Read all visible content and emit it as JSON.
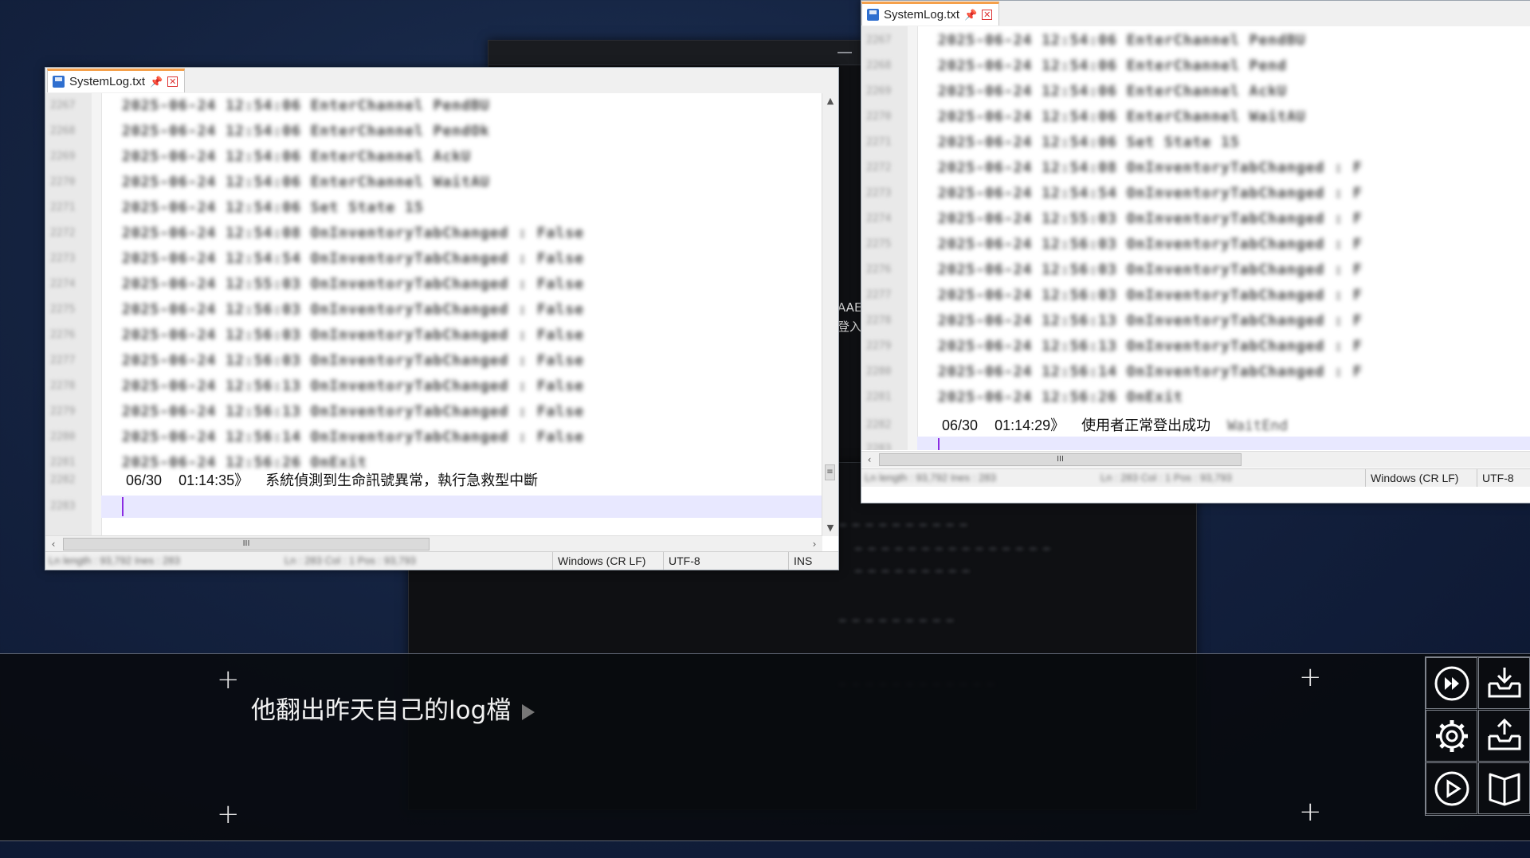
{
  "background_window": {
    "text_fragments": [
      "AAE",
      "登入"
    ]
  },
  "notepad_left": {
    "tab": {
      "title": "SystemLog.txt",
      "pin": "📌",
      "close": "✕"
    },
    "blurred_lines": [
      {
        "num": "2267",
        "text": "2025-06-24 12:54:06 EnterChannel PendBU"
      },
      {
        "num": "2268",
        "text": "2025-06-24 12:54:06 EnterChannel PendOk"
      },
      {
        "num": "2269",
        "text": "2025-06-24 12:54:06 EnterChannel AckU"
      },
      {
        "num": "2270",
        "text": "2025-06-24 12:54:06 EnterChannel WaitAU"
      },
      {
        "num": "2271",
        "text": "2025-06-24 12:54:06 Set State 15"
      },
      {
        "num": "2272",
        "text": "2025-06-24 12:54:08 OnInventoryTabChanged : False"
      },
      {
        "num": "2273",
        "text": "2025-06-24 12:54:54 OnInventoryTabChanged : False"
      },
      {
        "num": "2274",
        "text": "2025-06-24 12:55:03 OnInventoryTabChanged : False"
      },
      {
        "num": "2275",
        "text": "2025-06-24 12:56:03 OnInventoryTabChanged : False"
      },
      {
        "num": "2276",
        "text": "2025-06-24 12:56:03 OnInventoryTabChanged : False"
      },
      {
        "num": "2277",
        "text": "2025-06-24 12:56:03 OnInventoryTabChanged : False"
      },
      {
        "num": "2278",
        "text": "2025-06-24 12:56:13 OnInventoryTabChanged : False"
      },
      {
        "num": "2279",
        "text": "2025-06-24 12:56:13 OnInventoryTabChanged : False"
      },
      {
        "num": "2280",
        "text": "2025-06-24 12:56:14 OnInventoryTabChanged : False"
      },
      {
        "num": "2281",
        "text": "2025-06-24 12:56:26 OnExit"
      }
    ],
    "clear_line": {
      "date": "06/30",
      "time": "01:14:35》",
      "message": "系統偵測到生命訊號異常，執行急救型中斷"
    },
    "status": {
      "blur_left": "Ln length : 93,792   Ines : 283",
      "blur_mid": "Ln : 283   Col : 1   Pos : 93,793",
      "eol": "Windows (CR LF)",
      "encoding": "UTF-8",
      "mode": "INS"
    }
  },
  "notepad_right": {
    "tab": {
      "title": "SystemLog.txt",
      "pin": "📌",
      "close": "✕"
    },
    "blurred_lines": [
      {
        "num": "2267",
        "text": "2025-06-24 12:54:06 EnterChannel PendBU"
      },
      {
        "num": "2268",
        "text": "2025-06-24 12:54:06 EnterChannel Pend"
      },
      {
        "num": "2269",
        "text": "2025-06-24 12:54:06 EnterChannel AckU"
      },
      {
        "num": "2270",
        "text": "2025-06-24 12:54:06 EnterChannel WaitAU"
      },
      {
        "num": "2271",
        "text": "2025-06-24 12:54:06 Set State 15"
      },
      {
        "num": "2272",
        "text": "2025-06-24 12:54:08 OnInventoryTabChanged : F"
      },
      {
        "num": "2273",
        "text": "2025-06-24 12:54:54 OnInventoryTabChanged : F"
      },
      {
        "num": "2274",
        "text": "2025-06-24 12:55:03 OnInventoryTabChanged : F"
      },
      {
        "num": "2275",
        "text": "2025-06-24 12:56:03 OnInventoryTabChanged : F"
      },
      {
        "num": "2276",
        "text": "2025-06-24 12:56:03 OnInventoryTabChanged : F"
      },
      {
        "num": "2277",
        "text": "2025-06-24 12:56:03 OnInventoryTabChanged : F"
      },
      {
        "num": "2278",
        "text": "2025-06-24 12:56:13 OnInventoryTabChanged : F"
      },
      {
        "num": "2279",
        "text": "2025-06-24 12:56:13 OnInventoryTabChanged : F"
      },
      {
        "num": "2280",
        "text": "2025-06-24 12:56:14 OnInventoryTabChanged : F"
      },
      {
        "num": "2281",
        "text": "2025-06-24 12:56:26 OnExit"
      }
    ],
    "clear_line": {
      "date": "06/30",
      "time": "01:14:29》",
      "message": "使用者正常登出成功",
      "blur_tail": "WaitEnd"
    },
    "status": {
      "blur_left": "Ln length : 93,792   Ines : 283",
      "blur_mid": "Ln : 283   Col : 1   Pos : 93,793",
      "eol": "Windows (CR LF)",
      "encoding": "UTF-8"
    }
  },
  "dialogue": {
    "text": "他翻出昨天自己的log檔"
  },
  "menu": {
    "icons": [
      "fast-forward-icon",
      "save-icon",
      "settings-icon",
      "load-icon",
      "auto-play-icon",
      "log-book-icon"
    ]
  },
  "colors": {
    "tab_accent": "#f5a04a",
    "caret": "#8a2be2",
    "current_line": "#e8e8ff",
    "dialog_bg": "#080a0e"
  }
}
